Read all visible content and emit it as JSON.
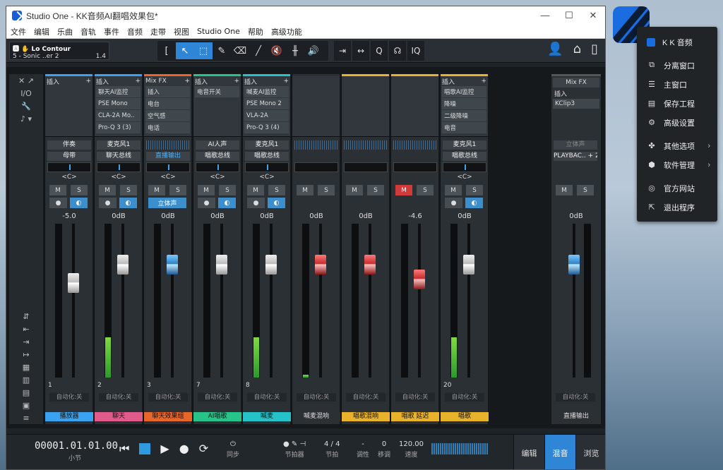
{
  "app": {
    "title": "Studio One - KK音频AI翻唱效果包*",
    "controls": [
      "—",
      "☐",
      "✕"
    ]
  },
  "menu": [
    "文件",
    "编辑",
    "乐曲",
    "音轨",
    "事件",
    "音频",
    "走带",
    "视图",
    "Studio One",
    "帮助",
    "高级功能"
  ],
  "instrument": {
    "name": "Lo Contour",
    "sub": "5 - Sonic ..er 2",
    "ver": "1.4"
  },
  "tools": [
    "[",
    "↖",
    "⬚",
    "✎",
    "⌫",
    "╱",
    "🔇",
    "╫",
    "🔊"
  ],
  "tools2": [
    "⇥",
    "↔",
    "Q",
    "☊",
    "IQ"
  ],
  "header_icons": [
    "👤",
    "⌂",
    "▯"
  ],
  "left_panel": [
    "✕  ↗",
    "I/O",
    "🔧",
    "♪ ▾"
  ],
  "left_panel_bottom": [
    "⇵",
    "⇤",
    "⇥",
    "↦",
    "▦",
    "▥",
    "▤",
    "▣",
    "≡"
  ],
  "strips": [
    {
      "bar": "#3aa2f0",
      "ins_head": "插入",
      "inserts": [],
      "l1": "伴奏",
      "l2": "母带",
      "l1hi": false,
      "l2hi": false,
      "pan": "<C>",
      "ms": [
        "M",
        "S"
      ],
      "red": false,
      "mon": [
        "●",
        "◐"
      ],
      "vol": "-5.0",
      "cap": "w",
      "capTop": 0.32,
      "meter": 0,
      "num": "1",
      "auto": "自动化:关",
      "name": "播放器",
      "ncolor": "#3aa2f0"
    },
    {
      "bar": "#3aa2f0",
      "ins_head": "插入",
      "inserts": [
        "聊天AI监控",
        "PSE Mono",
        "CLA-2A Mo..",
        "Pro-Q 3 (3)"
      ],
      "l1": "麦克风1",
      "l2": "聊天总线",
      "l1hi": false,
      "l2hi": false,
      "pan": "<C>",
      "ms": [
        "M",
        "S"
      ],
      "red": false,
      "mon": [
        "●",
        "◐"
      ],
      "vol": "0dB",
      "cap": "w",
      "capTop": 0.2,
      "meter": 0.26,
      "num": "2",
      "auto": "自动化:关",
      "name": "聊天",
      "ncolor": "#e05a8a"
    },
    {
      "bar": "#e8662a",
      "ins_head": "Mix FX",
      "inserts": [
        "插入",
        "电台",
        "空气感",
        "电话"
      ],
      "l1": "",
      "l2": "直播输出",
      "l1hi": false,
      "l2hi": true,
      "pan": "<C>",
      "ms": [
        "M",
        "S"
      ],
      "red": false,
      "mon": [
        "立体声"
      ],
      "vol": "0dB",
      "cap": "b",
      "capTop": 0.2,
      "meter": 0,
      "num": "3",
      "auto": "自动化:关",
      "name": "聊天效果组",
      "ncolor": "#e8662a"
    },
    {
      "bar": "#27c48a",
      "ins_head": "插入",
      "inserts": [
        "电音开关"
      ],
      "l1": "AI人声",
      "l2": "唱歌总线",
      "l1hi": false,
      "l2hi": false,
      "pan": "<C>",
      "ms": [
        "M",
        "S"
      ],
      "red": false,
      "mon": [
        "●",
        "◐"
      ],
      "vol": "0dB",
      "cap": "w",
      "capTop": 0.2,
      "meter": 0,
      "num": "7",
      "auto": "自动化:关",
      "name": "AI唱歌",
      "ncolor": "#27c48a"
    },
    {
      "bar": "#25c2c8",
      "ins_head": "插入",
      "inserts": [
        "喊麦AI监控",
        "PSE Mono 2",
        "VLA-2A",
        "Pro-Q 3 (4)"
      ],
      "l1": "麦克风1",
      "l2": "唱歌总线",
      "l1hi": false,
      "l2hi": false,
      "pan": "<C>",
      "ms": [
        "M",
        "S"
      ],
      "red": false,
      "mon": [
        "●",
        "◐"
      ],
      "vol": "0dB",
      "cap": "w",
      "capTop": 0.2,
      "meter": 0.26,
      "num": "8",
      "auto": "自动化:关",
      "name": "喊麦",
      "ncolor": "#25c2c8"
    },
    {
      "bar": "",
      "ins_head": "",
      "inserts": [],
      "l1": "",
      "l2": "",
      "l1hi": false,
      "l2hi": false,
      "pan": "",
      "ms": [
        "M",
        "S"
      ],
      "red": false,
      "mon": [],
      "vol": "0dB",
      "cap": "r",
      "capTop": 0.2,
      "meter": 0.02,
      "num": "",
      "auto": "自动化:关",
      "name": "喊麦混响",
      "ncolor": ""
    },
    {
      "bar": "#e8b22a",
      "ins_head": "",
      "inserts": [],
      "l1": "",
      "l2": "",
      "l1hi": false,
      "l2hi": false,
      "pan": "",
      "ms": [
        "M",
        "S"
      ],
      "red": false,
      "mon": [],
      "vol": "0dB",
      "cap": "r",
      "capTop": 0.2,
      "meter": 0,
      "num": "",
      "auto": "自动化:关",
      "name": "唱歌混响",
      "ncolor": "#e8b22a"
    },
    {
      "bar": "#e8b22a",
      "ins_head": "",
      "inserts": [],
      "l1": "",
      "l2": "",
      "l1hi": false,
      "l2hi": false,
      "pan": "",
      "ms": [
        "M",
        "S"
      ],
      "red": true,
      "mon": [],
      "vol": "-4.6",
      "cap": "r",
      "capTop": 0.3,
      "meter": 0,
      "num": "",
      "auto": "自动化:关",
      "name": "唱歌 延迟",
      "ncolor": "#e8b22a"
    },
    {
      "bar": "#e8b22a",
      "ins_head": "插入",
      "inserts": [
        "唱歌AI监控",
        "降噪",
        "二级降噪",
        "电音"
      ],
      "l1": "麦克风1",
      "l2": "唱歌总线",
      "l1hi": false,
      "l2hi": false,
      "pan": "<C>",
      "ms": [
        "M",
        "S"
      ],
      "red": false,
      "mon": [
        "●",
        "◐"
      ],
      "vol": "0dB",
      "cap": "w",
      "capTop": 0.2,
      "meter": 0.26,
      "num": "20",
      "auto": "自动化:关",
      "name": "唱歌",
      "ncolor": "#e8b22a"
    }
  ],
  "output": {
    "fx": "Mix FX",
    "ins": "插入",
    "plugin": "KClip3",
    "l1": "立体声",
    "l2": "PLAYBAC.. + 2",
    "ms": [
      "M",
      "S"
    ],
    "vol": "0dB",
    "auto": "自动化:关",
    "name": "直播输出"
  },
  "transport": {
    "time": "00001.01.01.00",
    "unit": "小节",
    "sync": "同步",
    "metro": "节拍器",
    "sig": "4 / 4",
    "sig_l": "节拍",
    "key": "-",
    "key_l": "调性",
    "trans": "0",
    "trans_l": "移调",
    "tempo": "120.00",
    "tempo_l": "速度"
  },
  "views": [
    "编辑",
    "混音",
    "浏览"
  ],
  "popup": [
    {
      "icon": "",
      "label": "K K 音频",
      "arrow": ""
    },
    {
      "icon": "⧉",
      "label": "分离窗口",
      "arrow": ""
    },
    {
      "icon": "☰",
      "label": "主窗口",
      "arrow": ""
    },
    {
      "icon": "▤",
      "label": "保存工程",
      "arrow": ""
    },
    {
      "icon": "⚙",
      "label": "高级设置",
      "arrow": ""
    },
    {
      "icon": "✤",
      "label": "其他选项",
      "arrow": "›"
    },
    {
      "icon": "⬢",
      "label": "软件管理",
      "arrow": "›"
    },
    {
      "icon": "◎",
      "label": "官方网站",
      "arrow": ""
    },
    {
      "icon": "⇱",
      "label": "退出程序",
      "arrow": ""
    }
  ]
}
